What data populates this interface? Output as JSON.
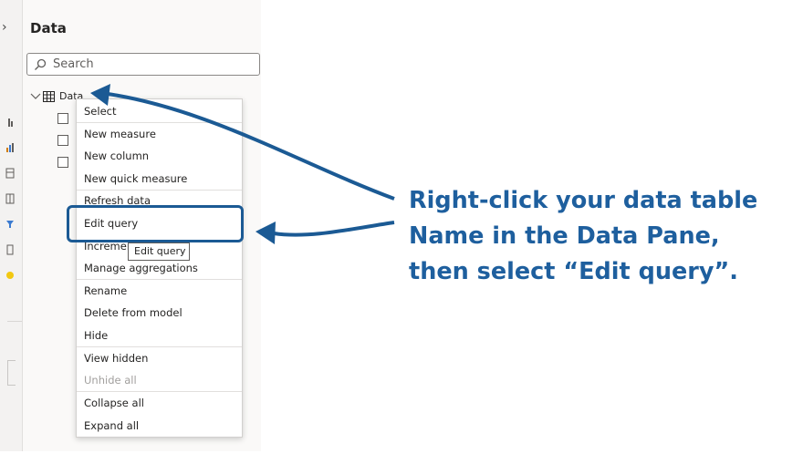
{
  "pane": {
    "title": "Data",
    "search_placeholder": "Search",
    "table_name": "Data"
  },
  "context_menu": {
    "items": [
      {
        "label": "Select",
        "enabled": true
      },
      {
        "label": "New measure",
        "enabled": true
      },
      {
        "label": "New column",
        "enabled": true
      },
      {
        "label": "New quick measure",
        "enabled": true
      },
      {
        "label": "Refresh data",
        "enabled": true
      },
      {
        "label": "Edit query",
        "enabled": true
      },
      {
        "label": "Incremental refresh",
        "enabled": true
      },
      {
        "label": "Manage aggregations",
        "enabled": true
      },
      {
        "label": "Rename",
        "enabled": true
      },
      {
        "label": "Delete from model",
        "enabled": true
      },
      {
        "label": "Hide",
        "enabled": true
      },
      {
        "label": "View hidden",
        "enabled": true
      },
      {
        "label": "Unhide all",
        "enabled": false
      },
      {
        "label": "Collapse all",
        "enabled": true
      },
      {
        "label": "Expand all",
        "enabled": true
      }
    ]
  },
  "tooltip": {
    "text": "Edit query"
  },
  "instruction": {
    "line1": "Right-click your data table",
    "line2": "Name in the Data Pane,",
    "line3": "then select “Edit query”."
  },
  "colors": {
    "annotation": "#1e5f9e",
    "highlight_border": "#1b5a94"
  }
}
